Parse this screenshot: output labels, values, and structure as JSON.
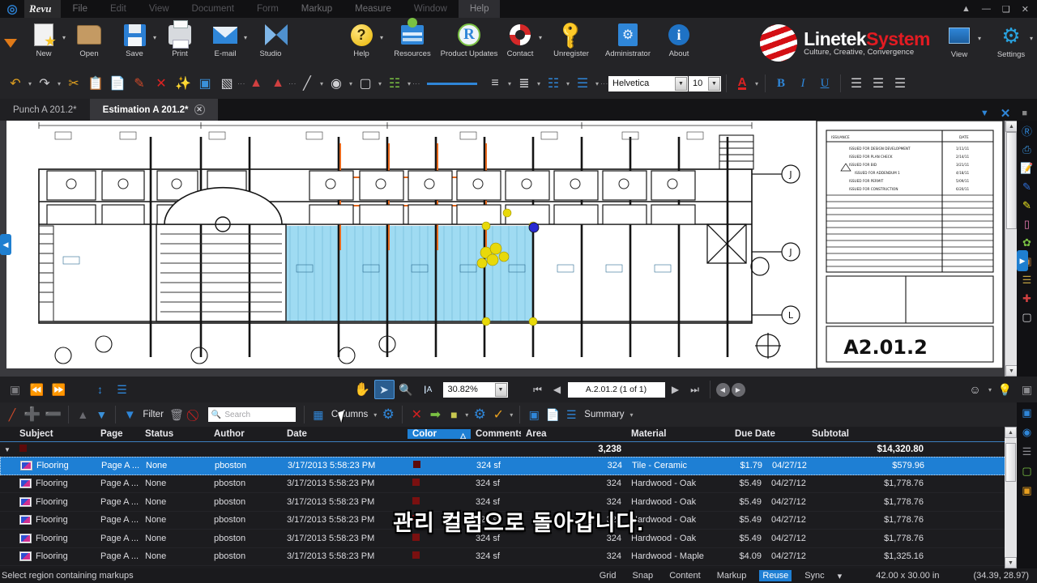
{
  "app": {
    "brand": "Revu",
    "logo": {
      "line1_white": "Linetek",
      "line1_red": "System",
      "line2": "Culture, Creative, Convergence"
    },
    "accent": "#1e7fd4",
    "markup_red": "#7a1010"
  },
  "menubar": {
    "items": [
      "File",
      "Edit",
      "View",
      "Document",
      "Form",
      "Markup",
      "Measure",
      "Window",
      "Help"
    ],
    "active": "Help",
    "window_controls": [
      "▲",
      "—",
      "❑",
      "✕"
    ]
  },
  "ribbon": {
    "buttons": [
      {
        "label": "New",
        "icon": "new-document-icon",
        "dropdown": true
      },
      {
        "label": "Open",
        "icon": "open-folder-icon",
        "dropdown": false
      },
      {
        "label": "Save",
        "icon": "save-disk-icon",
        "dropdown": true
      },
      {
        "label": "Print",
        "icon": "printer-icon",
        "dropdown": false
      },
      {
        "label": "E-mail",
        "icon": "envelope-icon",
        "dropdown": true
      },
      {
        "label": "Studio",
        "icon": "studio-icon",
        "dropdown": false
      },
      {
        "label": "Help",
        "icon": "help-question-icon",
        "dropdown": true
      },
      {
        "label": "Resources",
        "icon": "resources-icon",
        "dropdown": false
      },
      {
        "label": "Product Updates",
        "icon": "product-updates-icon",
        "dropdown": false
      },
      {
        "label": "Contact",
        "icon": "lifering-contact-icon",
        "dropdown": true
      },
      {
        "label": "Unregister",
        "icon": "key-icon",
        "dropdown": false
      },
      {
        "label": "Administrator",
        "icon": "administrator-icon",
        "dropdown": false
      },
      {
        "label": "About",
        "icon": "info-icon",
        "dropdown": false
      }
    ],
    "right_buttons": [
      {
        "label": "View",
        "icon": "view-icon",
        "dropdown": true
      },
      {
        "label": "Settings",
        "icon": "gear-icon",
        "dropdown": true
      }
    ]
  },
  "toolbar2": {
    "icons": [
      "undo-icon",
      "redo-icon",
      "cut-scissors-icon",
      "copy-icon",
      "paste-icon",
      "format-painter-icon",
      "delete-x-icon",
      "magic-wand-icon",
      "snapshot-icon",
      "stamp-icon",
      "flatten-icon",
      "unflatten-icon",
      "pen-icon",
      "highlighter-icon",
      "fill-color-icon",
      "hatch-pattern-icon",
      "line-style-icon",
      "align-icon",
      "distribute-icon",
      "spacing-icon",
      "group-icon"
    ],
    "font_family": "Helvetica",
    "font_size": "10",
    "bold": "B",
    "italic": "I",
    "underline": "U",
    "text_color_glyph": "A"
  },
  "tabs": {
    "items": [
      {
        "label": "Punch A 201.2*",
        "active": false,
        "closable": false
      },
      {
        "label": "Estimation A 201.2*",
        "active": true,
        "closable": true
      }
    ]
  },
  "drawing": {
    "sheet_number": "A2.01.2",
    "revision_table": {
      "headers": [
        "ISSUANCE",
        "DATE"
      ],
      "rows": [
        "ISSUED FOR DESIGN DEVELOPMENT",
        "ISSUED FOR PLAN CHECK",
        "ISSUED FOR BID",
        "ISSUED FOR ADDENDUM 1",
        "ISSUED FOR PERMIT",
        "ISSUED FOR CONSTRUCTION"
      ]
    },
    "grid_labels_right": [
      "J",
      "J",
      "L"
    ],
    "highlight_color": "#8ed5f0",
    "control_point_color": "#e8d90a"
  },
  "viewbar": {
    "left_icons": [
      "fit-page-icon",
      "previous-view-icon",
      "next-view-icon",
      "fit-width-icon",
      "fit-height-icon"
    ],
    "tools": [
      "pan-hand-icon",
      "select-arrow-icon",
      "zoom-magnifier-icon",
      "text-select-icon"
    ],
    "zoom_level": "30.82%",
    "page_indicator": "A.2.01.2 (1 of 1)",
    "nav_icons": [
      "first-page-icon",
      "previous-page-icon",
      "next-page-icon",
      "last-page-icon",
      "back-icon",
      "forward-icon"
    ]
  },
  "markup_toolbar": {
    "icons_left": [
      "markup-pen-icon",
      "add-plus-icon",
      "remove-minus-icon",
      "move-up-icon",
      "move-down-icon"
    ],
    "filter_label": "Filter",
    "filter_icon": "funnel-icon",
    "trash_icon": "trash-icon",
    "clear-filter-icon": "no-entry-icon",
    "search_placeholder": "Search",
    "columns_label": "Columns",
    "columns_icon": "columns-icon",
    "settings_icon": "gear-icon",
    "icons_right": [
      "delete-x-icon",
      "export-arrow-icon",
      "status-traffic-icon",
      "properties-gear-icon",
      "checkmark-icon",
      "report-icon",
      "export-document-icon",
      "list-icon"
    ],
    "summary_label": "Summary"
  },
  "table": {
    "columns": [
      "Subject",
      "Page",
      "Status",
      "Author",
      "Date",
      "Color",
      "Comments",
      "Area",
      "Material",
      "Due Date",
      "Subtotal"
    ],
    "sorted_column": "Color",
    "sort_direction": "△",
    "summary_row": {
      "area": "3,238",
      "subtotal": "$14,320.80"
    },
    "rows": [
      {
        "subject": "Flooring",
        "page": "Page A ...",
        "status": "None",
        "author": "pboston",
        "date": "3/17/2013 5:58:23 PM",
        "comments": "324 sf",
        "area": "324",
        "material": "Tile - Ceramic",
        "due_date": "$1.79",
        "due2": "04/27/12",
        "subtotal": "$579.96",
        "selected": true
      },
      {
        "subject": "Flooring",
        "page": "Page A ...",
        "status": "None",
        "author": "pboston",
        "date": "3/17/2013 5:58:23 PM",
        "comments": "324 sf",
        "area": "324",
        "material": "Hardwood - Oak",
        "due_date": "$5.49",
        "due2": "04/27/12",
        "subtotal": "$1,778.76",
        "selected": false
      },
      {
        "subject": "Flooring",
        "page": "Page A ...",
        "status": "None",
        "author": "pboston",
        "date": "3/17/2013 5:58:23 PM",
        "comments": "324 sf",
        "area": "324",
        "material": "Hardwood - Oak",
        "due_date": "$5.49",
        "due2": "04/27/12",
        "subtotal": "$1,778.76",
        "selected": false
      },
      {
        "subject": "Flooring",
        "page": "Page A ...",
        "status": "None",
        "author": "pboston",
        "date": "3/17/2013 5:58:23 PM",
        "comments": "324 sf",
        "area": "324",
        "material": "Hardwood - Oak",
        "due_date": "$5.49",
        "due2": "04/27/12",
        "subtotal": "$1,778.76",
        "selected": false
      },
      {
        "subject": "Flooring",
        "page": "Page A ...",
        "status": "None",
        "author": "pboston",
        "date": "3/17/2013 5:58:23 PM",
        "comments": "324 sf",
        "area": "324",
        "material": "Hardwood - Oak",
        "due_date": "$5.49",
        "due2": "04/27/12",
        "subtotal": "$1,778.76",
        "selected": false
      },
      {
        "subject": "Flooring",
        "page": "Page A ...",
        "status": "None",
        "author": "pboston",
        "date": "3/17/2013 5:58:23 PM",
        "comments": "324 sf",
        "area": "324",
        "material": "Hardwood - Maple",
        "due_date": "$4.09",
        "due2": "04/27/12",
        "subtotal": "$1,325.16",
        "selected": false
      }
    ]
  },
  "statusbar": {
    "message": "Select region containing markups",
    "toggles": [
      "Grid",
      "Snap",
      "Content",
      "Markup",
      "Reuse",
      "Sync"
    ],
    "active_toggle": "Reuse",
    "sync_caret": "▾",
    "page_size": "42.00 x 30.00 in",
    "coordinates": "(34.39, 28.97)"
  },
  "subtitle": {
    "text": "관리 컬럼으로 돌아갑니다."
  }
}
